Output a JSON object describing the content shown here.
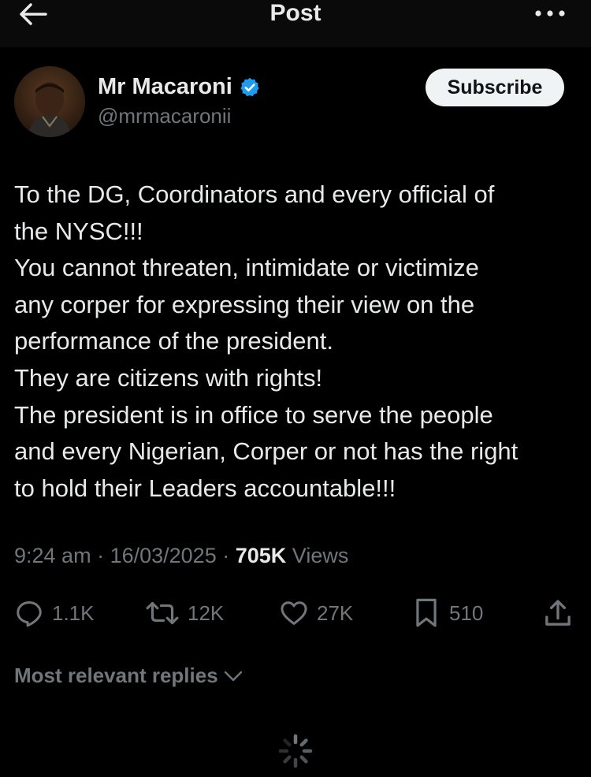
{
  "header": {
    "title": "Post",
    "back_icon": "arrow-left-icon",
    "more_icon": "more-horizontal-icon"
  },
  "author": {
    "name": "Mr Macaroni",
    "handle": "@mrmacaronii",
    "verified": true,
    "verified_icon": "verified-badge-icon",
    "verified_color": "#1d9bf0",
    "subscribe_label": "Subscribe"
  },
  "post": {
    "lines": [
      "To the DG, Coordinators and every official of",
      "the NYSC!!!",
      "You cannot threaten, intimidate or victimize",
      "any corper for expressing their view on the",
      "performance of the president.",
      "They are citizens with rights!",
      "The president is in office to serve the people",
      "and every Nigerian, Corper or not has the right",
      "to hold their Leaders accountable!!!"
    ]
  },
  "meta": {
    "time": "9:24 am",
    "date": "16/03/2025",
    "views_count": "705K",
    "views_label": "Views"
  },
  "actions": {
    "replies": "1.1K",
    "reposts": "12K",
    "likes": "27K",
    "bookmarks": "510"
  },
  "replies_filter": {
    "label": "Most relevant replies"
  },
  "colors": {
    "background": "#000000",
    "text": "#e7e9ea",
    "secondary": "#71767b",
    "accent": "#1d9bf0"
  }
}
